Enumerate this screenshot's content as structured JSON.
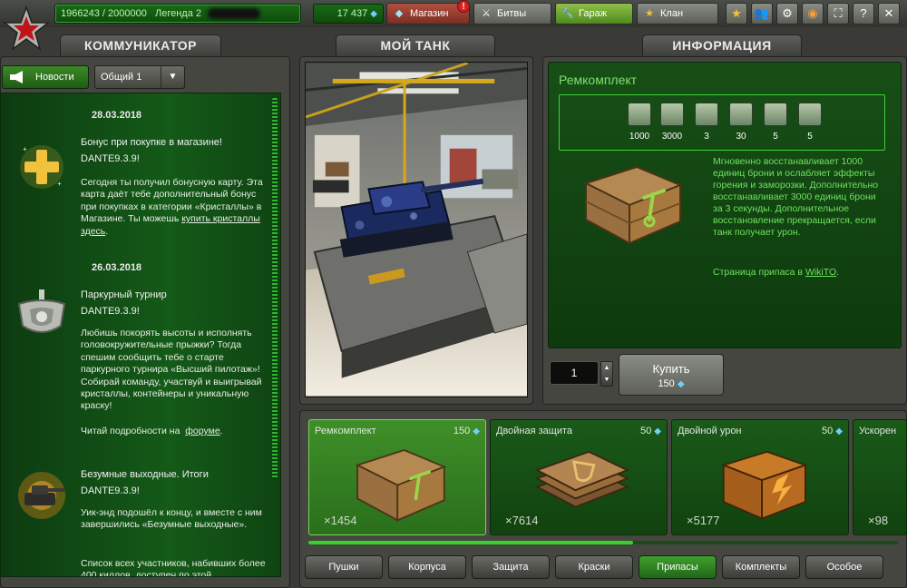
{
  "topbar": {
    "experience": "1966243 / 2000000",
    "rank": "Легенда 2",
    "crystals": "17 437",
    "buttons": {
      "shop": "Магазин",
      "battles": "Битвы",
      "garage": "Гараж",
      "clan": "Клан"
    },
    "shop_badge": "!",
    "icons": [
      "star-icon",
      "friends-icon",
      "settings-icon",
      "sound-icon",
      "fullscreen-icon",
      "help-icon"
    ]
  },
  "tabs": {
    "communicator": "КОММУНИКАТОР",
    "my_tank": "МОЙ ТАНК",
    "info": "ИНФОРМАЦИЯ"
  },
  "communicator": {
    "news_button": "Новости",
    "channel_select": "Общий 1",
    "news": [
      {
        "date": "28.03.2018",
        "title": "Бонус при покупке в магазине!",
        "author": "DANTE9.3.9!",
        "body": "Сегодня ты получил бонусную карту. Эта карта даёт тебе дополнительный бонус при покупках в категории «Кристаллы» в Магазине. Ты можешь",
        "link": "купить кристаллы здесь",
        "link_suffix": "."
      },
      {
        "date": "26.03.2018",
        "title": "Паркурный турнир",
        "author": "DANTE9.3.9!",
        "body": "Любишь покорять высоты и исполнять головокружительные прыжки? Тогда спешим сообщить тебе о старте паркурного турнира «Высший пилотаж»! Собирай команду, участвуй и выигрывай кристаллы, контейнеры и уникальную краску!",
        "more_prefix": "Читай подробности на",
        "link": "форуме",
        "link_suffix": "."
      },
      {
        "title": "Безумные выходные. Итоги",
        "author": "DANTE9.3.9!",
        "body": "Уик-энд подошёл к концу, и вместе с ним завершились «Безумные выходные».",
        "body2": "Список всех участников, набивших более 400 киллов, доступен по этой"
      }
    ]
  },
  "info": {
    "title": "Ремкомплект",
    "stats": [
      {
        "icon": "armor-repair-icon",
        "value": "1000"
      },
      {
        "icon": "armor-regen-icon",
        "value": "3000"
      },
      {
        "icon": "timer-icon",
        "value": "3"
      },
      {
        "icon": "cooldown-icon",
        "value": "30"
      },
      {
        "icon": "fire-icon",
        "value": "5"
      },
      {
        "icon": "freeze-icon",
        "value": "5"
      }
    ],
    "description": "Мгновенно восстанавливает 1000 единиц брони и ослабляет эффекты горения и заморозки. Дополнительно восстанавливает 3000 единиц брони за 3 секунды. Дополнительное восстановление прекращается, если танк получает урон.",
    "wiki_prefix": "Страница припаса в",
    "wiki_link": "WikiTO",
    "wiki_suffix": ".",
    "quantity": "1",
    "buy_label": "Купить",
    "buy_price": "150"
  },
  "items": [
    {
      "name": "Ремкомплект",
      "price": "150",
      "count": "×1454"
    },
    {
      "name": "Двойная защита",
      "price": "50",
      "count": "×7614"
    },
    {
      "name": "Двойной урон",
      "price": "50",
      "count": "×5177"
    },
    {
      "name": "Ускорен",
      "price": "",
      "count": "×98"
    }
  ],
  "shelf_scroll": 0.55,
  "categories": [
    "Пушки",
    "Корпуса",
    "Защита",
    "Краски",
    "Припасы",
    "Комплекты",
    "Особое"
  ],
  "active_category": "Припасы",
  "colors": {
    "accent_green": "#3ed236",
    "panel_green": "#145a18",
    "info_text": "#6fe060",
    "crystal_blue": "#6fd0ff",
    "badge_red": "#d62020"
  }
}
